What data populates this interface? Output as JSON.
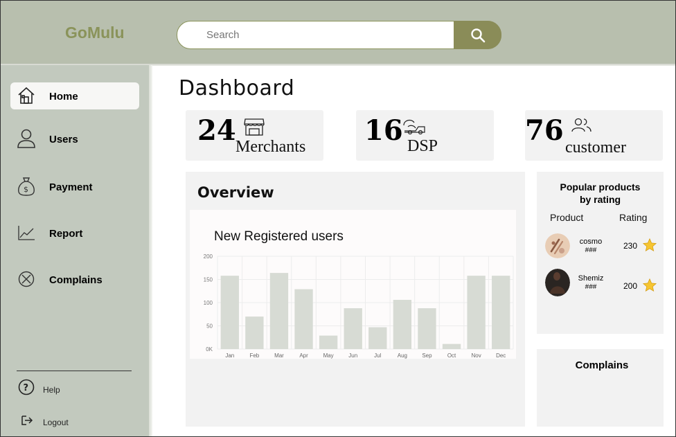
{
  "app": {
    "logo": "GoMulu"
  },
  "search": {
    "placeholder": "Search"
  },
  "sidebar": {
    "items": [
      {
        "label": "Home",
        "icon": "home-icon",
        "active": true
      },
      {
        "label": "Users",
        "icon": "user-icon"
      },
      {
        "label": "Payment",
        "icon": "money-bag-icon"
      },
      {
        "label": "Report",
        "icon": "line-chart-icon"
      },
      {
        "label": "Complains",
        "icon": "circle-x-icon"
      }
    ],
    "help": "Help",
    "logout": "Logout"
  },
  "page": {
    "title": "Dashboard"
  },
  "stats": [
    {
      "value": "24",
      "label": "Merchants",
      "icon": "store-icon"
    },
    {
      "value": "16",
      "label": "DSP",
      "icon": "delivery-icon"
    },
    {
      "value": "76",
      "label": "customer",
      "icon": "people-icon"
    }
  ],
  "overview": {
    "title": "Overview"
  },
  "chart_data": {
    "type": "bar",
    "title": "New Registered users",
    "categories": [
      "Jan",
      "Feb",
      "Mar",
      "Apr",
      "May",
      "Jun",
      "Jul",
      "Aug",
      "Sep",
      "Oct",
      "Nov",
      "Dec"
    ],
    "values": [
      158,
      70,
      164,
      129,
      29,
      88,
      47,
      106,
      88,
      11,
      158,
      158
    ],
    "ylim": [
      0,
      200
    ],
    "yticks": [
      0,
      50,
      100,
      150,
      200
    ],
    "ytick_labels": [
      "0K",
      "50",
      "100",
      "150",
      "200"
    ],
    "grid": true,
    "colors": {
      "bar": "#d7dbd4",
      "grid": "#ececec"
    }
  },
  "popular": {
    "title_line1": "Popular products",
    "title_line2": "by rating",
    "col_product": "Product",
    "col_rating": "Rating",
    "rows": [
      {
        "name": "cosmo",
        "id": "###",
        "rating": "230"
      },
      {
        "name": "Shemiz",
        "id": "###",
        "rating": "200"
      }
    ]
  },
  "complains": {
    "title": "Complains"
  },
  "colors": {
    "header": "#b8bfae",
    "sidebar": "#c2c9be",
    "accent": "#8a935a",
    "search_button": "#8a8c58"
  }
}
